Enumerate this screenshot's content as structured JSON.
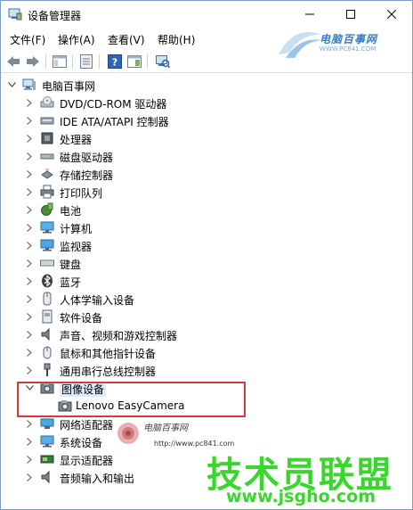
{
  "window": {
    "title": "设备管理器"
  },
  "menu": [
    "文件(F)",
    "操作(A)",
    "查看(V)",
    "帮助(H)"
  ],
  "top_watermark": {
    "brand": "电脑百事网",
    "url": "WWW.PC841.COM"
  },
  "tree": {
    "root": "电脑百事网",
    "items": [
      "DVD/CD-ROM 驱动器",
      "IDE ATA/ATAPI 控制器",
      "处理器",
      "磁盘驱动器",
      "存储控制器",
      "打印队列",
      "电池",
      "计算机",
      "监视器",
      "键盘",
      "蓝牙",
      "人体学输入设备",
      "软件设备",
      "声音、视频和游戏控制器",
      "鼠标和其他指针设备",
      "通用串行总线控制器",
      "图像设备",
      "Lenovo EasyCamera",
      "网络适配器",
      "系统设备",
      "显示适配器",
      "音频输入和输出"
    ]
  },
  "mid_watermark": {
    "brand": "电脑百事网",
    "url": "http://www.pc841.com"
  },
  "bottom_watermark": {
    "brand": "技术员联盟",
    "url": "www.jsgho.com"
  }
}
